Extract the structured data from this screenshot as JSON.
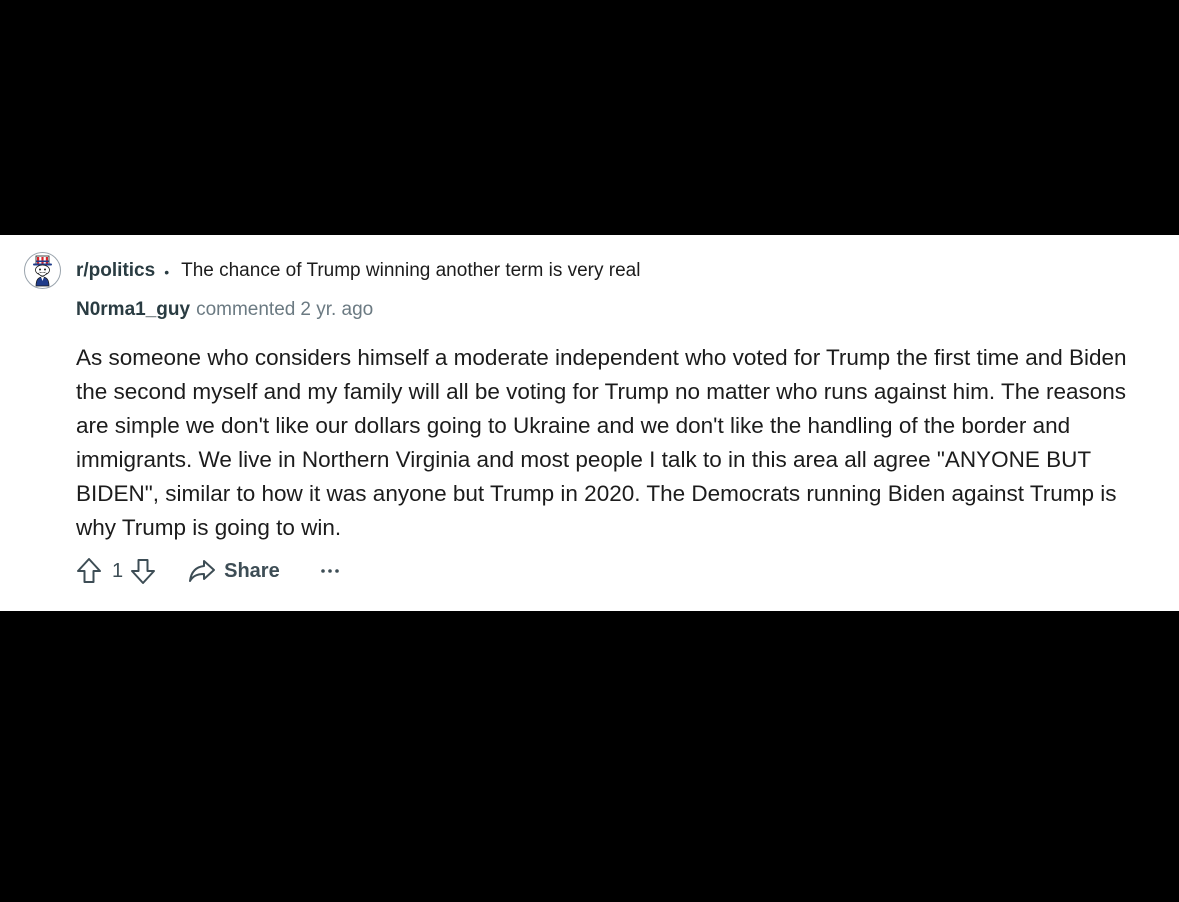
{
  "post": {
    "subreddit": "r/politics",
    "separator": "•",
    "title": "The chance of Trump winning another term is very real"
  },
  "comment": {
    "author": "N0rma1_guy",
    "action": "commented",
    "age": "2 yr. ago",
    "body": "As someone who considers himself a moderate independent who voted for Trump the first time and Biden the second myself and my family will all be voting for Trump no matter who runs against him. The reasons are simple we don't like our dollars going to Ukraine and we don't like the handling of the border and immigrants. We live in Northern Virginia and most people I talk to in this area all agree \"ANYONE BUT BIDEN\", similar to how it was anyone but Trump in 2020. The Democrats running Biden against Trump is why Trump is going to win.",
    "vote_count": "1"
  },
  "actions": {
    "share_label": "Share",
    "upvote_icon": "upvote-icon",
    "downvote_icon": "downvote-icon",
    "share_icon": "share-icon",
    "more_icon": "more-options-icon"
  },
  "colors": {
    "background": "#000000",
    "card": "#ffffff",
    "text_primary": "#1c1c1c",
    "text_meta": "#6b7a82",
    "text_strong": "#2a3c42"
  }
}
